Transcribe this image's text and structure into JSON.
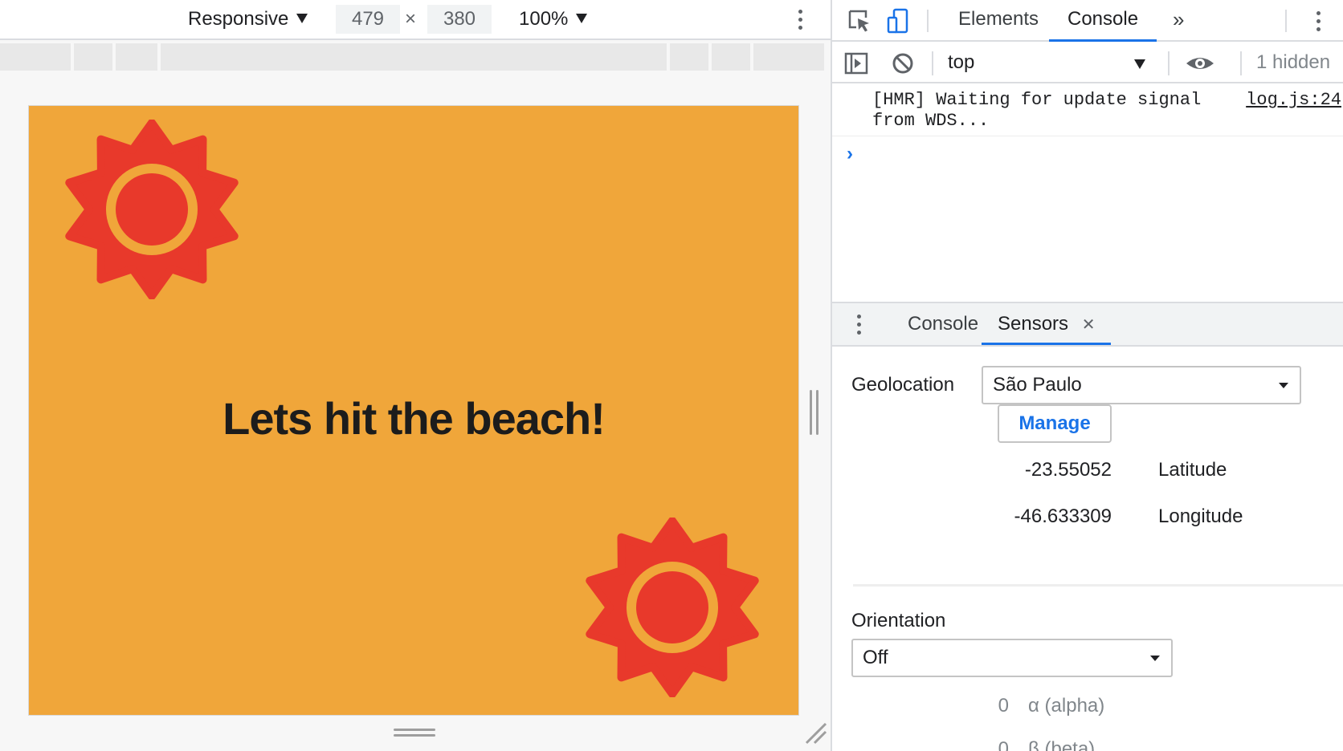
{
  "device_toolbar": {
    "device_label": "Responsive",
    "width_value": "479",
    "times_symbol": "×",
    "height_value": "380",
    "zoom_label": "100%"
  },
  "emulated_page": {
    "heading": "Lets hit the beach!",
    "background_color": "#f0a63a",
    "sun_color": "#e8392b"
  },
  "devtools": {
    "tabs": [
      "Elements",
      "Console"
    ],
    "active_tab": "Console",
    "more_tabs_glyph": "»",
    "console_toolbar": {
      "context": "top",
      "hidden_count": "1 hidden"
    },
    "console_messages": [
      {
        "text": "[HMR] Waiting for update signal from WDS...",
        "source": "log.js:24"
      }
    ],
    "prompt_glyph": "›",
    "drawer": {
      "tabs": [
        "Console",
        "Sensors"
      ],
      "active_tab": "Sensors",
      "close_glyph": "✕",
      "geolocation": {
        "label": "Geolocation",
        "selected": "São Paulo",
        "manage_label": "Manage",
        "latitude_value": "-23.55052",
        "latitude_label": "Latitude",
        "longitude_value": "-46.633309",
        "longitude_label": "Longitude"
      },
      "orientation": {
        "label": "Orientation",
        "selected": "Off",
        "alpha_value": "0",
        "alpha_label": "α (alpha)",
        "beta_value": "0",
        "beta_label": "β (beta)"
      }
    },
    "accent_color": "#1a73e8"
  }
}
